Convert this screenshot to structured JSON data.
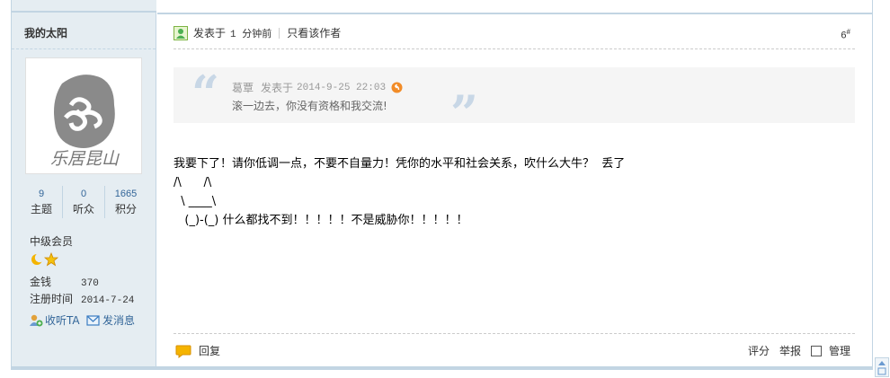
{
  "sidebar": {
    "username": "我的太阳",
    "avatar_text": "乐居昆山",
    "stats": [
      {
        "value": "9",
        "label": "主题"
      },
      {
        "value": "0",
        "label": "听众"
      },
      {
        "value": "1665",
        "label": "积分"
      }
    ],
    "grade": "中级会员",
    "money_label": "金钱",
    "money_value": "370",
    "register_label": "注册时间",
    "register_value": "2014-7-24",
    "follow_label": "收听TA",
    "message_label": "发消息"
  },
  "post": {
    "posted_prefix": "发表于",
    "posted_time": "1 分钟前",
    "only_author": "只看该作者",
    "floor": "6",
    "floor_suffix": "#",
    "quote_author": "葛覃",
    "quote_posted": "发表于",
    "quote_time": "2014-9-25 22:03",
    "quote_text": "滚一边去，你没有资格和我交流!",
    "content_line1": "我要下了！请你低调一点，不要不自量力！凭你的水平和社会关系，吹什么大牛？  丢了",
    "content_line2": "/\\      /\\",
    "content_line3": "  \\ ____\\",
    "content_line4": "   (_)-(_) 什么都找不到！！！！！不是威胁你！！！！！",
    "reply_label": "回复",
    "rate_label": "评分",
    "report_label": "举报",
    "manage_label": "管理"
  },
  "colors": {
    "link": "#336699",
    "border": "#c2d5e3",
    "sidebar_bg": "#e5edf2",
    "quote_bg": "#f5f5f5"
  }
}
